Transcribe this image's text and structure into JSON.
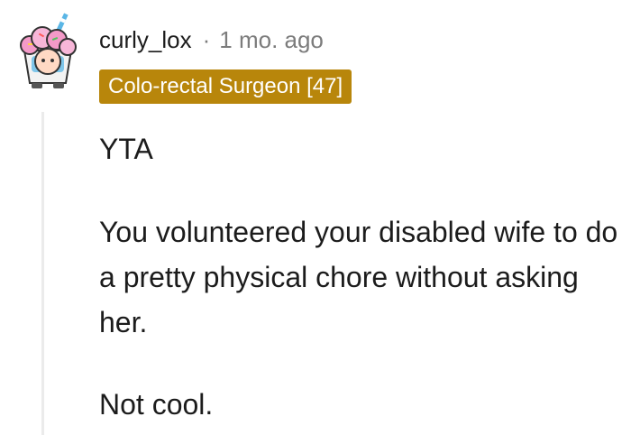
{
  "comment": {
    "author": "curly_lox",
    "separator": "·",
    "timestamp": "1 mo. ago",
    "flair": "Colo-rectal Surgeon [47]",
    "avatar_icon": "snoo-avatar-icon",
    "paragraphs": [
      "YTA",
      "You volunteered your disabled wife to do a pretty physical chore without asking her.",
      "Not cool."
    ]
  },
  "colors": {
    "flair_background": "#b8860b",
    "flair_text": "#ffffff",
    "meta_text": "#7c7c7c",
    "body_text": "#1c1c1c",
    "thread_line": "#ebebeb"
  }
}
